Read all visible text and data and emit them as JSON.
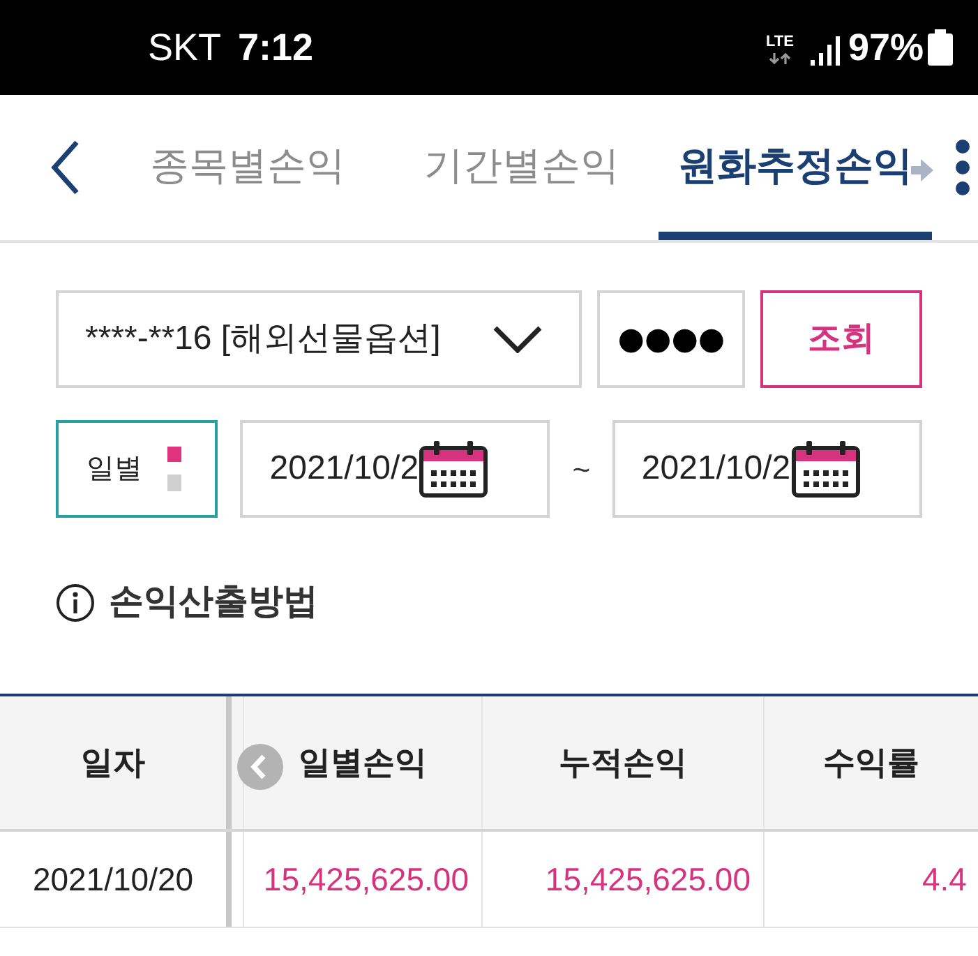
{
  "status_bar": {
    "carrier": "SKT",
    "time": "7:12",
    "network": "LTE",
    "battery": "97%"
  },
  "nav": {
    "tabs": [
      {
        "label": "종목별손익",
        "selected": false
      },
      {
        "label": "기간별손익",
        "selected": false
      },
      {
        "label": "원화추정손익",
        "selected": true
      }
    ]
  },
  "form": {
    "account": "****-**16 [해외선물옵션]",
    "password": "●●●●",
    "search_button": "조회",
    "period": "일별",
    "start_date": "2021/10/2",
    "separator": "~",
    "end_date": "2021/10/2"
  },
  "info_link": "손익산출방법",
  "table": {
    "columns": [
      "일자",
      "일별손익",
      "누적손익",
      "수익률"
    ],
    "rows": [
      {
        "date": "2021/10/20",
        "daily_pnl": "15,425,625.00",
        "cumulative_pnl": "15,425,625.00",
        "return_rate": "4.4"
      }
    ]
  }
}
